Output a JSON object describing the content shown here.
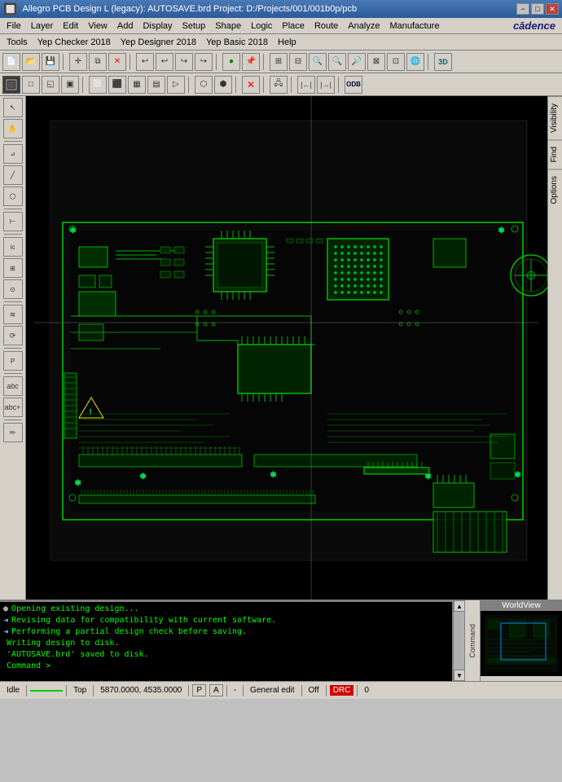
{
  "titlebar": {
    "title": "Allegro PCB Design L (legacy): AUTOSAVE.brd  Project: D:/Projects/001/001b0p/pcb",
    "minimize": "−",
    "maximize": "□",
    "close": "✕"
  },
  "menubar": {
    "items": [
      "File",
      "Layer",
      "Edit",
      "View",
      "Add",
      "Display",
      "Setup",
      "Shape",
      "Logic",
      "Place",
      "Route",
      "Analyze",
      "Manufacture"
    ]
  },
  "menubar2": {
    "items": [
      "Tools",
      "Yep Checker 2018",
      "Yep Designer 2018",
      "Yep Basic 2018",
      "Help"
    ]
  },
  "cadence_logo": "cādence",
  "right_panel": {
    "tabs": [
      "Visibility",
      "Find",
      "Options"
    ]
  },
  "console": {
    "header": "Command >",
    "lines": [
      {
        "icon": "●",
        "text": "Opening existing design..."
      },
      {
        "icon": "◄",
        "text": "Revising data for compatibility with current software."
      },
      {
        "icon": "◄",
        "text": "Performing a partial design check before saving."
      },
      {
        "icon": "",
        "text": "Writing design to disk."
      },
      {
        "icon": "",
        "text": "'AUTOSAVE.brd' saved to disk."
      },
      {
        "icon": "",
        "text": "Command >"
      }
    ]
  },
  "minimap": {
    "header": "WorldView"
  },
  "statusbar": {
    "status": "Idle",
    "green_indicator": "",
    "layer": "Top",
    "coordinates": "5870.0000, 4535.0000",
    "pa_btn": "P",
    "a_btn": "A",
    "dash": "-",
    "general_edit": "General edit",
    "off": "Off",
    "red_indicator": "DRC",
    "number": "0"
  }
}
